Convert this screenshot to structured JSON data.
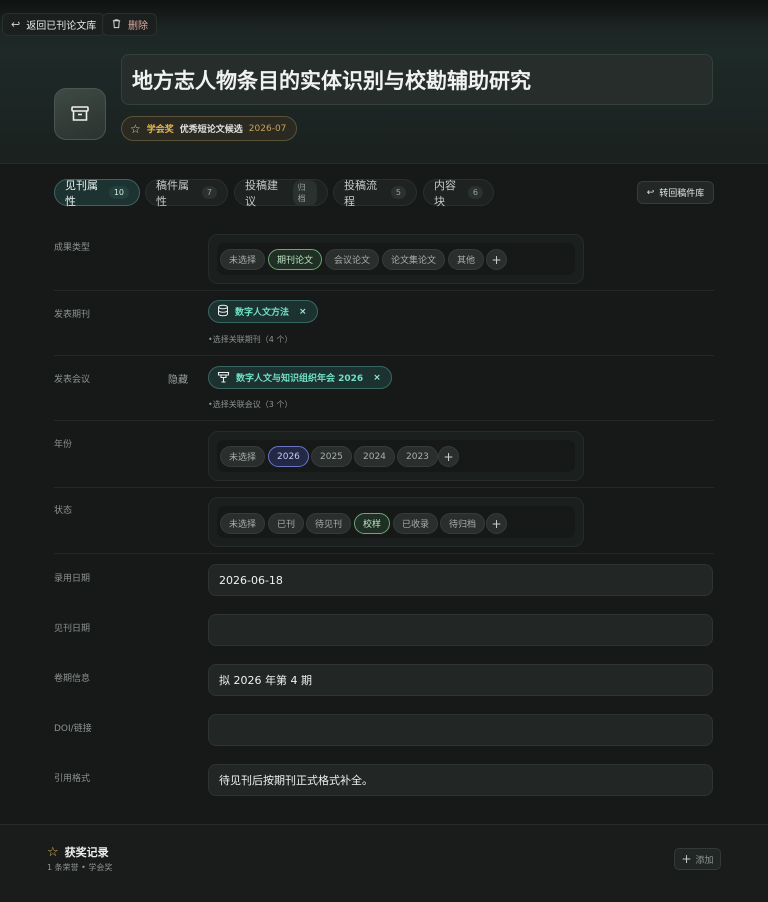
{
  "topbar": {
    "back_label": "返回已刊论文库",
    "delete_label": "删除"
  },
  "header": {
    "title": "地方志人物条目的实体识别与校勘辅助研究",
    "award": {
      "kind": "学会奖",
      "name": "优秀短论文候选",
      "date": "2026-07"
    }
  },
  "tabs": [
    {
      "label": "见刊属性",
      "count": "10"
    },
    {
      "label": "稿件属性",
      "count": "7"
    },
    {
      "label": "投稿建议",
      "count": "归档"
    },
    {
      "label": "投稿流程",
      "count": "5"
    },
    {
      "label": "内容块",
      "count": "6"
    }
  ],
  "return_button": "转回稿件库",
  "form": {
    "type": {
      "label": "成果类型",
      "options": [
        "未选择",
        "期刊论文",
        "会议论文",
        "论文集论文",
        "其他"
      ],
      "selected": "期刊论文"
    },
    "journal": {
      "label": "发表期刊",
      "tag": "数字人文方法",
      "hint": "•选择关联期刊（4 个）"
    },
    "conference": {
      "label": "发表会议",
      "hidden_label": "隐藏",
      "tag": "数字人文与知识组织年会 2026",
      "hint": "•选择关联会议（3 个）"
    },
    "year": {
      "label": "年份",
      "options": [
        "未选择",
        "2026",
        "2025",
        "2024",
        "2023"
      ],
      "selected": "2026"
    },
    "status": {
      "label": "状态",
      "options": [
        "未选择",
        "已刊",
        "待见刊",
        "校样",
        "已收录",
        "待归档"
      ],
      "selected": "校样"
    },
    "accept_date": {
      "label": "录用日期",
      "value": "2026-06-18"
    },
    "publish_date": {
      "label": "见刊日期",
      "value": ""
    },
    "volume": {
      "label": "卷期信息",
      "value": "拟 2026 年第 4 期"
    },
    "doi": {
      "label": "DOI/链接",
      "value": ""
    },
    "citation": {
      "label": "引用格式",
      "value": "待见刊后按期刊正式格式补全。"
    }
  },
  "awards_section": {
    "title": "获奖记录",
    "subtitle": "1 条荣誉 • 学会奖",
    "add_label": "添加"
  },
  "colors": {
    "accent_teal": "#6fe0c4",
    "gold": "#e2b657",
    "green_select": "#6aa877",
    "blue_select": "#6a76c4"
  }
}
